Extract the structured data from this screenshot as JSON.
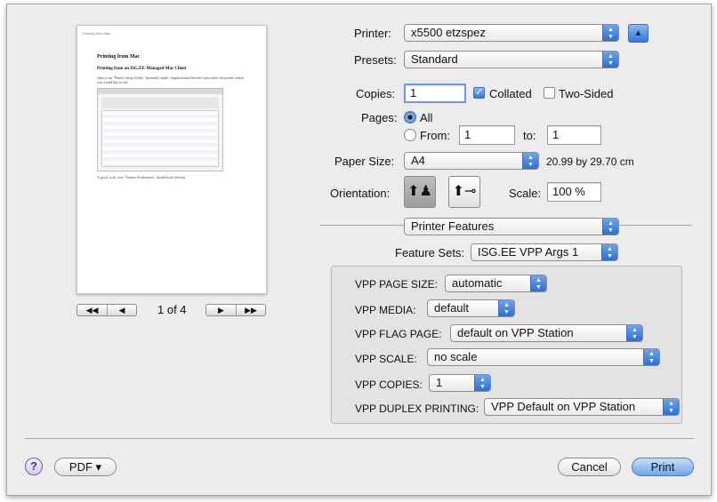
{
  "preview": {
    "page_header_left": "Printing from Mac",
    "page_title": "Printing from Mac",
    "page_subtitle": "Printing from an ISG.EE-Managed Mac Client",
    "page_body": "Open your \"Printer Setup Utility\" (normally under /Applications/Utilities/) and select the printer which you would like to use.",
    "page_caption": "A good, look, over \"System Preferences\" should look like this.",
    "page_indicator": "1 of 4",
    "first_label": "◀◀",
    "prev_label": "◀",
    "next_label": "▶",
    "last_label": "▶▶"
  },
  "printer": {
    "label": "Printer:",
    "value": "x5500 etzspez"
  },
  "presets": {
    "label": "Presets:",
    "value": "Standard"
  },
  "copies": {
    "label": "Copies:",
    "value": "1",
    "collated_label": "Collated",
    "collated": true,
    "two_sided_label": "Two-Sided",
    "two_sided": false
  },
  "pages": {
    "label": "Pages:",
    "all_label": "All",
    "from_label": "From:",
    "from_value": "1",
    "to_label": "to:",
    "to_value": "1"
  },
  "paper": {
    "label": "Paper Size:",
    "value": "A4",
    "dimensions": "20.99 by 29.70 cm"
  },
  "orientation": {
    "label": "Orientation:",
    "scale_label": "Scale:",
    "scale_value": "100 %"
  },
  "section": {
    "value": "Printer Features"
  },
  "feature_sets": {
    "label": "Feature Sets:",
    "value": "ISG.EE VPP Args 1"
  },
  "vpp": {
    "page_size": {
      "label": "VPP PAGE SIZE:",
      "value": "automatic"
    },
    "media": {
      "label": "VPP MEDIA:",
      "value": "default"
    },
    "flag_page": {
      "label": "VPP FLAG PAGE:",
      "value": "default on VPP Station"
    },
    "scale": {
      "label": "VPP SCALE:",
      "value": "no scale"
    },
    "copies": {
      "label": "VPP COPIES:",
      "value": "1"
    },
    "duplex": {
      "label": "VPP DUPLEX PRINTING:",
      "value": "VPP Default on VPP Station"
    }
  },
  "footer": {
    "help": "?",
    "pdf_label": "PDF ▾",
    "cancel_label": "Cancel",
    "print_label": "Print"
  }
}
